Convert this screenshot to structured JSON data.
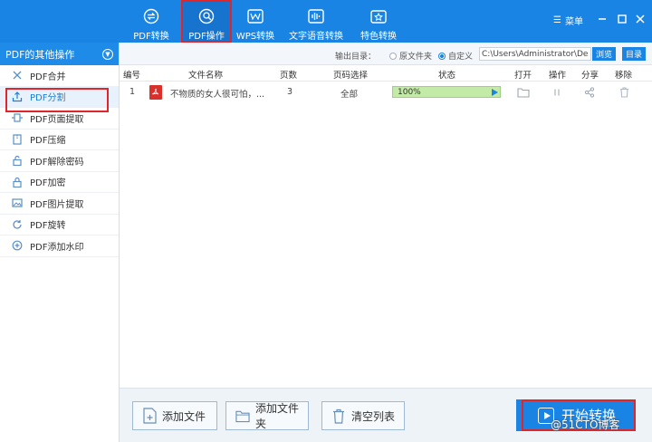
{
  "header": {
    "tabs": [
      {
        "label": "PDF转换",
        "icon": "pdf-convert-icon"
      },
      {
        "label": "PDF操作",
        "icon": "pdf-operation-icon",
        "active": true
      },
      {
        "label": "WPS转换",
        "icon": "wps-icon"
      },
      {
        "label": "文字语音转换",
        "icon": "voice-wave-icon"
      },
      {
        "label": "特色转换",
        "icon": "special-convert-icon"
      }
    ],
    "menu_label": "菜单"
  },
  "sidebar": {
    "title": "PDF的其他操作",
    "items": [
      {
        "label": "PDF合并",
        "icon": "merge-icon"
      },
      {
        "label": "PDF分割",
        "icon": "split-icon",
        "active": true
      },
      {
        "label": "PDF页面提取",
        "icon": "page-extract-icon"
      },
      {
        "label": "PDF压缩",
        "icon": "compress-icon"
      },
      {
        "label": "PDF解除密码",
        "icon": "unlock-icon"
      },
      {
        "label": "PDF加密",
        "icon": "lock-icon"
      },
      {
        "label": "PDF图片提取",
        "icon": "image-extract-icon"
      },
      {
        "label": "PDF旋转",
        "icon": "rotate-icon"
      },
      {
        "label": "PDF添加水印",
        "icon": "watermark-add-icon"
      }
    ]
  },
  "toolbar": {
    "output_label": "输出目录：",
    "option_original": "原文件夹",
    "option_custom": "自定义",
    "selected_option": "自定义",
    "path_value": "C:\\Users\\Administrator\\Deskto",
    "browse_label": "浏览",
    "directory_label": "目录"
  },
  "table": {
    "columns": [
      "编号",
      "文件名称",
      "页数",
      "页码选择",
      "状态",
      "打开",
      "操作",
      "分享",
      "移除"
    ],
    "rows": [
      {
        "index": "1",
        "file_name": "不物质的女人很可怕，...",
        "pages": "3",
        "page_select": "全部",
        "status": "100%",
        "progress": 1.0
      }
    ]
  },
  "bottom": {
    "add_file": "添加文件",
    "add_folder": "添加文件夹",
    "clear_list": "清空列表",
    "start": "开始转换"
  },
  "watermark": "@51CTO博客",
  "colors": {
    "brand_blue": "#1a84e5",
    "highlight_red": "#e0262b",
    "progress_green": "#d9f2c6"
  }
}
